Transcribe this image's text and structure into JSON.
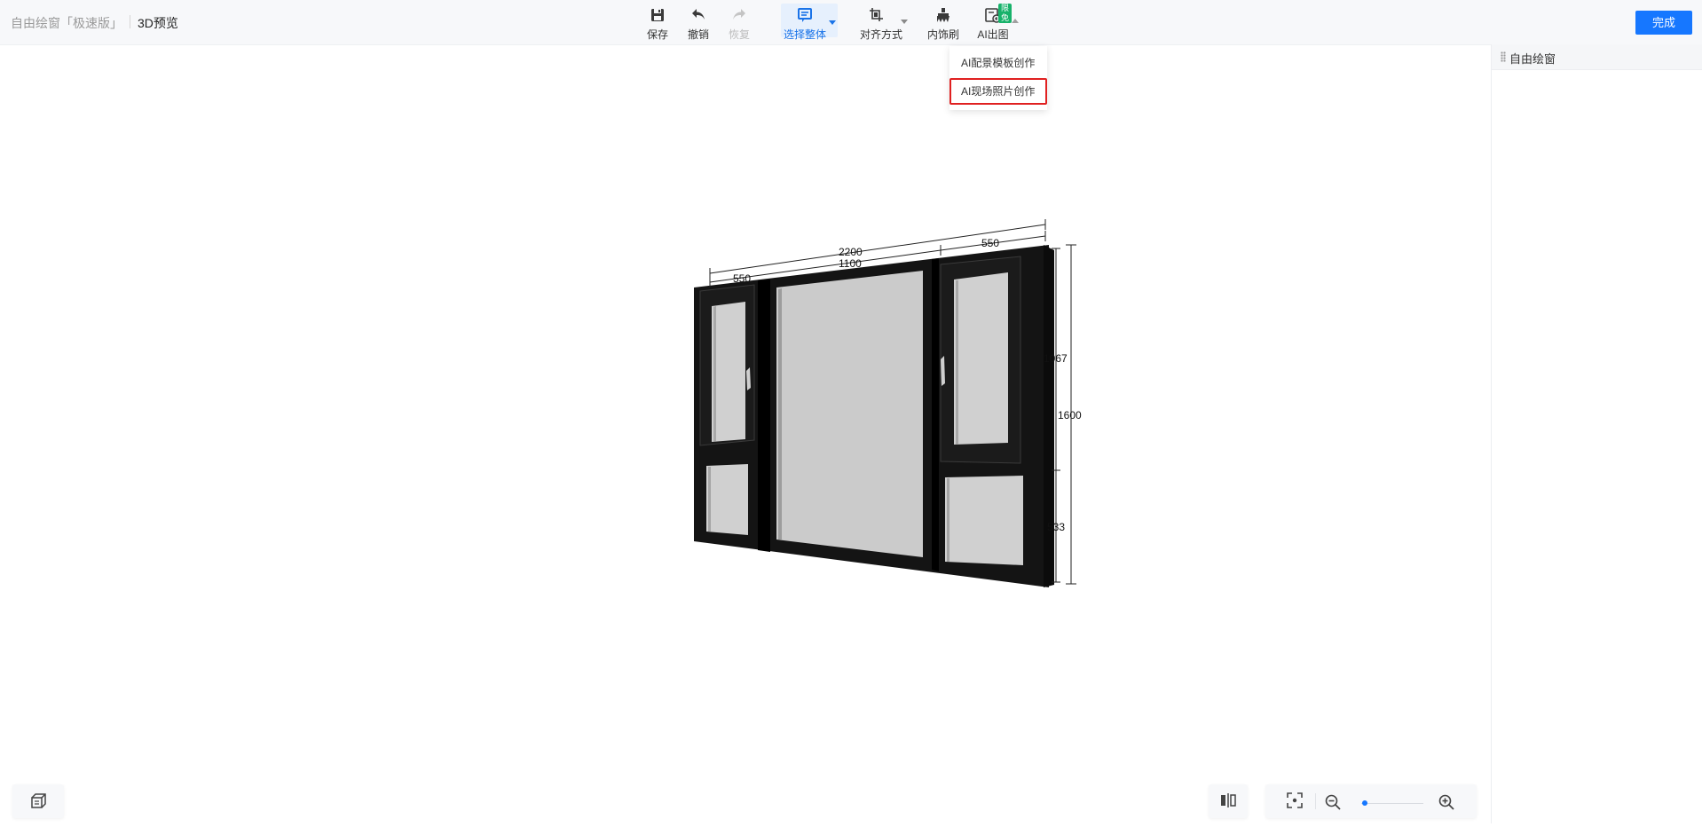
{
  "header": {
    "app_title": "自由绘窗「极速版」",
    "page_title": "3D预览",
    "finish_label": "完成",
    "free_badge": "限免"
  },
  "toolbar": {
    "items": [
      {
        "label": "保存",
        "icon": "save-icon",
        "state": "enabled"
      },
      {
        "label": "撤销",
        "icon": "undo-icon",
        "state": "enabled"
      },
      {
        "label": "恢复",
        "icon": "redo-icon",
        "state": "disabled"
      },
      {
        "label": "选择整体",
        "icon": "select-whole-icon",
        "state": "active"
      },
      {
        "label": "对齐方式",
        "icon": "align-icon",
        "state": "enabled"
      },
      {
        "label": "内饰刷",
        "icon": "brush-icon",
        "state": "enabled"
      },
      {
        "label": "AI出图",
        "icon": "ai-image-icon",
        "state": "enabled"
      }
    ]
  },
  "ai_menu": {
    "items": [
      {
        "label": "AI配景模板创作"
      },
      {
        "label": "AI现场照片创作",
        "highlighted": true
      }
    ]
  },
  "right_panel": {
    "title": "自由绘窗"
  },
  "dimensions": {
    "total_width": "2200",
    "middle_width": "1100",
    "left_width": "550",
    "right_width": "550",
    "total_height": "1600",
    "upper_height": "1067",
    "lower_height": "533"
  },
  "bottom_controls": {
    "zoom_fraction": 0.05
  },
  "colors": {
    "accent": "#1677ff",
    "highlight_border": "#e02020",
    "frame": "#141414",
    "glass": "#cfcfcf",
    "badge": "#17b26a"
  }
}
